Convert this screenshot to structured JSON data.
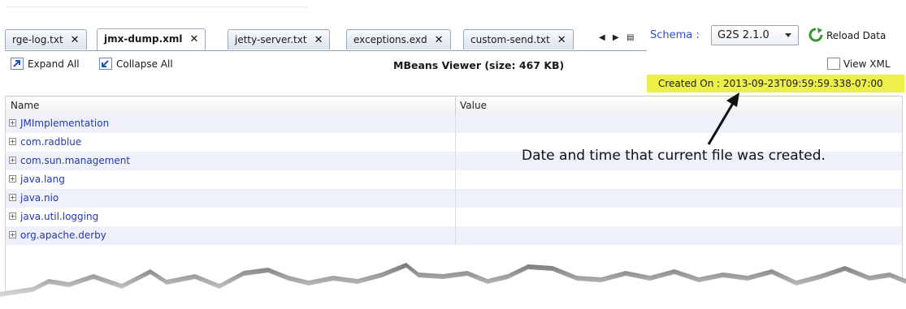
{
  "tabs": [
    {
      "label": "rge-log.txt",
      "active": false
    },
    {
      "label": "jmx-dump.xml",
      "active": true
    },
    {
      "label": "jetty-server.txt",
      "active": false
    },
    {
      "label": "exceptions.exd",
      "active": false
    },
    {
      "label": "custom-send.txt",
      "active": false
    }
  ],
  "tab_close_glyph": "✕",
  "schema": {
    "label": "Schema :",
    "selected": "G2S 2.1.0"
  },
  "reload_label": "Reload Data",
  "toolbar": {
    "expand_all": "Expand All",
    "collapse_all": "Collapse All",
    "viewer_title": "MBeans Viewer (size: 467 KB)",
    "view_xml": "View XML"
  },
  "created_on": "Created On : 2013-09-23T09:59:59.338-07:00",
  "table": {
    "columns": [
      "Name",
      "Value"
    ],
    "rows": [
      "JMImplementation",
      "com.radblue",
      "com.sun.management",
      "java.lang",
      "java.nio",
      "java.util.logging",
      "org.apache.derby"
    ]
  },
  "annotation": "Date and time that current file was created.",
  "colors": {
    "accent": "#2a4fd6",
    "highlight": "#eef04a",
    "row_alt": "#eef0fa",
    "link": "#2639a8"
  },
  "icons": [
    "close-icon",
    "tab-left-icon",
    "tab-right-icon",
    "tab-list-icon",
    "dropdown-caret-icon",
    "reload-icon",
    "expand-all-icon",
    "collapse-all-icon",
    "view-xml-icon",
    "tree-expand-icon",
    "arrow-icon"
  ]
}
